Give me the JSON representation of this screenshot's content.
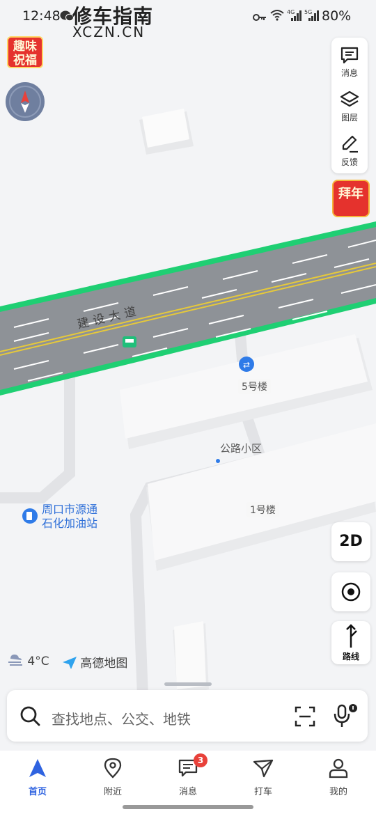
{
  "status_bar": {
    "time": "12:48",
    "battery": "80%",
    "watermark_cn": "修车指南",
    "watermark_en": "XCZN.CN"
  },
  "top_left": {
    "greeting_line1": "趣味",
    "greeting_line2": "祝福"
  },
  "toolbar": {
    "messages": "消息",
    "layers": "图层",
    "feedback": "反馈"
  },
  "new_year_badge": "拜年",
  "map": {
    "road_name": "建设大道",
    "building_5": "5号楼",
    "community": "公路小区",
    "building_1": "1号楼",
    "gas_station_line1": "周口市源通",
    "gas_station_line2": "石化加油站"
  },
  "controls": {
    "mode_2d": "2D",
    "route_label": "路线"
  },
  "weather": {
    "temperature": "4°C"
  },
  "brand": {
    "name": "高德地图"
  },
  "search": {
    "placeholder": "查找地点、公交、地铁"
  },
  "bottom_nav": {
    "items": [
      {
        "label": "首页",
        "active": true
      },
      {
        "label": "附近",
        "active": false
      },
      {
        "label": "消息",
        "active": false,
        "badge": "3"
      },
      {
        "label": "打车",
        "active": false
      },
      {
        "label": "我的",
        "active": false
      }
    ]
  },
  "colors": {
    "accent": "#2f63e0",
    "road_edge": "#1fcf73",
    "road": "#8e9297",
    "festive_red": "#e5322d"
  }
}
